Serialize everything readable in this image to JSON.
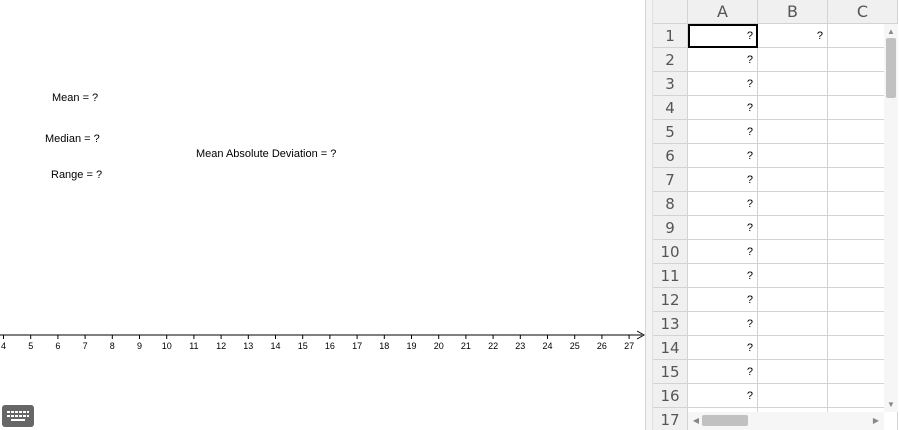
{
  "stats": {
    "mean": "Mean = ?",
    "median": "Median = ?",
    "range": "Range = ?",
    "mad": "Mean Absolute Deviation = ?"
  },
  "number_line": {
    "min": 4,
    "max": 27,
    "ticks": [
      4,
      5,
      6,
      7,
      8,
      9,
      10,
      11,
      12,
      13,
      14,
      15,
      16,
      17,
      18,
      19,
      20,
      21,
      22,
      23,
      24,
      25,
      26,
      27
    ]
  },
  "toolbar": {
    "keyboard_icon": "keyboard-icon"
  },
  "spreadsheet": {
    "columns": [
      "A",
      "B",
      "C"
    ],
    "rows": [
      "1",
      "2",
      "3",
      "4",
      "5",
      "6",
      "7",
      "8",
      "9",
      "10",
      "11",
      "12",
      "13",
      "14",
      "15",
      "16",
      "17"
    ],
    "cells": {
      "A": [
        "?",
        "?",
        "?",
        "?",
        "?",
        "?",
        "?",
        "?",
        "?",
        "?",
        "?",
        "?",
        "?",
        "?",
        "?",
        "?",
        ""
      ],
      "B": [
        "?",
        "",
        "",
        "",
        "",
        "",
        "",
        "",
        "",
        "",
        "",
        "",
        "",
        "",
        "",
        "",
        ""
      ],
      "C": [
        "",
        "",
        "",
        "",
        "",
        "",
        "",
        "",
        "",
        "",
        "",
        "",
        "",
        "",
        "",
        "",
        ""
      ]
    },
    "selected_cell": "A1"
  },
  "colors": {
    "axis": "#000000",
    "header_bg": "#f0f0f0",
    "grid": "#d3d3d3"
  }
}
